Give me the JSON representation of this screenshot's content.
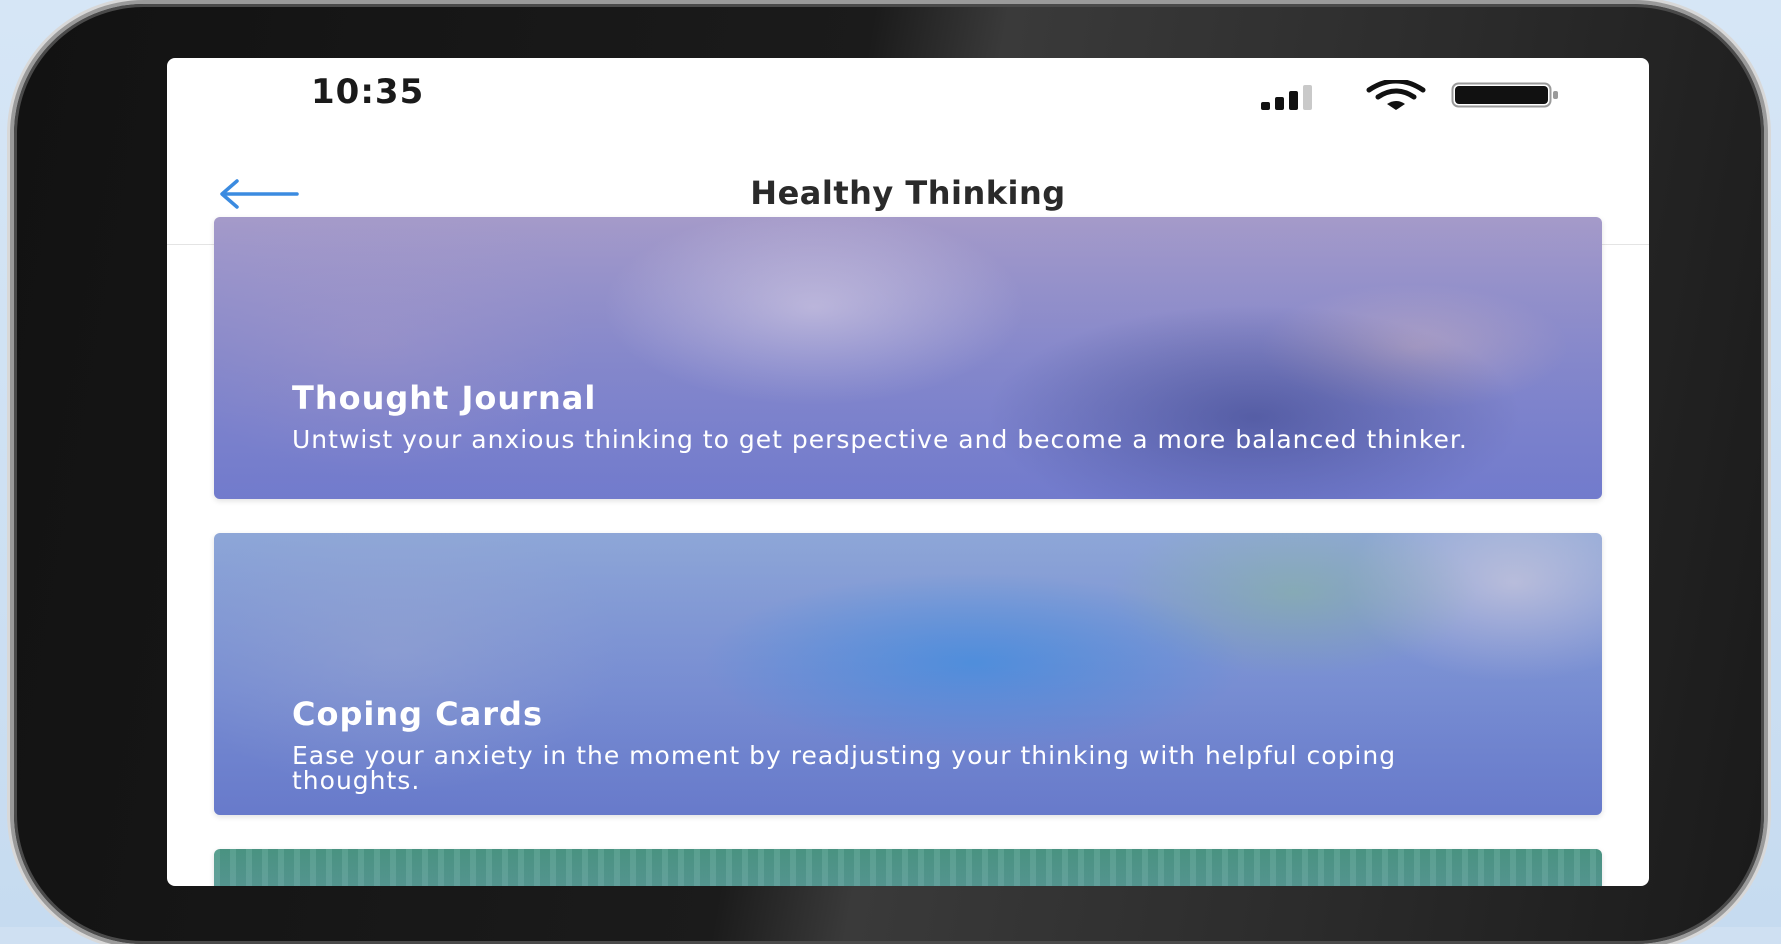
{
  "status_bar": {
    "time": "10:35",
    "icons": [
      "cellular-signal-icon",
      "wifi-icon",
      "battery-icon"
    ]
  },
  "nav": {
    "back_icon": "arrow-left-icon",
    "title": "Healthy Thinking"
  },
  "cards": [
    {
      "title": "Thought Journal",
      "description": "Untwist your anxious thinking to get perspective and become a more balanced thinker."
    },
    {
      "title": "Coping Cards",
      "description": "Ease your anxiety in the moment by readjusting your thinking with helpful coping thoughts."
    }
  ],
  "colors": {
    "accent": "#3b8be0",
    "card_1_tint": "#8d8fcc",
    "card_2_tint": "#7f98d5",
    "card_3_tint": "#5aa58f"
  }
}
